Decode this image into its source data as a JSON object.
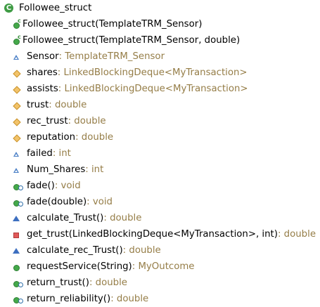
{
  "outline": {
    "class_name": "Followee_struct",
    "members": [
      {
        "icon": "constructor-icon",
        "name": "Followee_struct(TemplateTRM_Sensor)",
        "type": ""
      },
      {
        "icon": "constructor-icon",
        "name": "Followee_struct(TemplateTRM_Sensor, double)",
        "type": ""
      },
      {
        "icon": "package-field-icon",
        "name": "Sensor",
        "type": " : TemplateTRM_Sensor"
      },
      {
        "icon": "protected-field-icon",
        "name": "shares",
        "type": " : LinkedBlockingDeque<MyTransaction>"
      },
      {
        "icon": "protected-field-icon",
        "name": "assists",
        "type": " : LinkedBlockingDeque<MyTransaction>"
      },
      {
        "icon": "protected-field-icon",
        "name": "trust",
        "type": " : double"
      },
      {
        "icon": "protected-field-icon",
        "name": "rec_trust",
        "type": " : double"
      },
      {
        "icon": "protected-field-icon",
        "name": "reputation",
        "type": " : double"
      },
      {
        "icon": "package-field-icon",
        "name": "failed",
        "type": " : int"
      },
      {
        "icon": "package-field-icon",
        "name": "Num_Shares",
        "type": " : int"
      },
      {
        "icon": "public-static-method-icon",
        "name": "fade()",
        "type": " : void"
      },
      {
        "icon": "public-static-method-icon",
        "name": "fade(double)",
        "type": " : void"
      },
      {
        "icon": "package-method-icon",
        "name": "calculate_Trust()",
        "type": " : double"
      },
      {
        "icon": "private-method-icon",
        "name": "get_trust(LinkedBlockingDeque<MyTransaction>, int)",
        "type": " : double"
      },
      {
        "icon": "package-method-icon",
        "name": "calculate_rec_Trust()",
        "type": " : double"
      },
      {
        "icon": "public-method-icon",
        "name": "requestService(String)",
        "type": " : MyOutcome"
      },
      {
        "icon": "public-static-method-icon",
        "name": "return_trust()",
        "type": " : double"
      },
      {
        "icon": "public-static-method-icon",
        "name": "return_reliability()",
        "type": " : double"
      }
    ]
  },
  "colors": {
    "background": "#ffffff",
    "text": "#000000",
    "type_text": "#957d47",
    "public_green": "#44a94a",
    "protected_yellow": "#f2c36a",
    "package_blue": "#4a7fc6",
    "private_red": "#e05a5a"
  }
}
